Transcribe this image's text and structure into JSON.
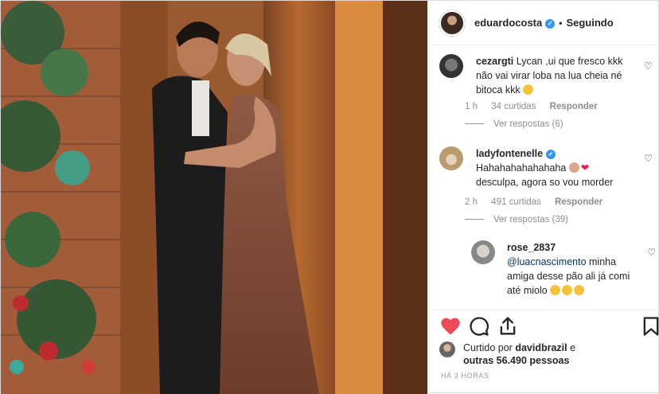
{
  "header": {
    "username": "eduardocosta",
    "separator": "•",
    "follow_status": "Seguindo"
  },
  "comments": [
    {
      "username": "cezargti",
      "text": "Lycan ,ui que fresco kkk não vai virar loba na lua cheia né bitoca kkk",
      "time": "1 h",
      "likes": "34 curtidas",
      "reply": "Responder",
      "view_replies": "Ver respostas (6)"
    },
    {
      "username": "ladyfontenelle",
      "text": "Hahahahahahahaha",
      "text2": "desculpa, agora so vou morder",
      "time": "2 h",
      "likes": "491 curtidas",
      "reply": "Responder",
      "view_replies": "Ver respostas (39)"
    },
    {
      "username": "rose_2837",
      "mention": "@luacnascimento",
      "text": " minha amiga desse pão ali já comi até miolo"
    }
  ],
  "liked_by": {
    "prefix": "Curtido por",
    "user": "davidbrazil",
    "conj": "e",
    "others": "outras 56.490 pessoas"
  },
  "timestamp": "HÁ 3 HORAS",
  "icons": [
    "heart-icon",
    "comment-icon",
    "share-icon",
    "bookmark-icon",
    "verified-badge-icon"
  ],
  "colors": {
    "like_red": "#ed4956",
    "verified_blue": "#3897f0",
    "mention_blue": "#003569",
    "muted": "#8e8e8e"
  }
}
